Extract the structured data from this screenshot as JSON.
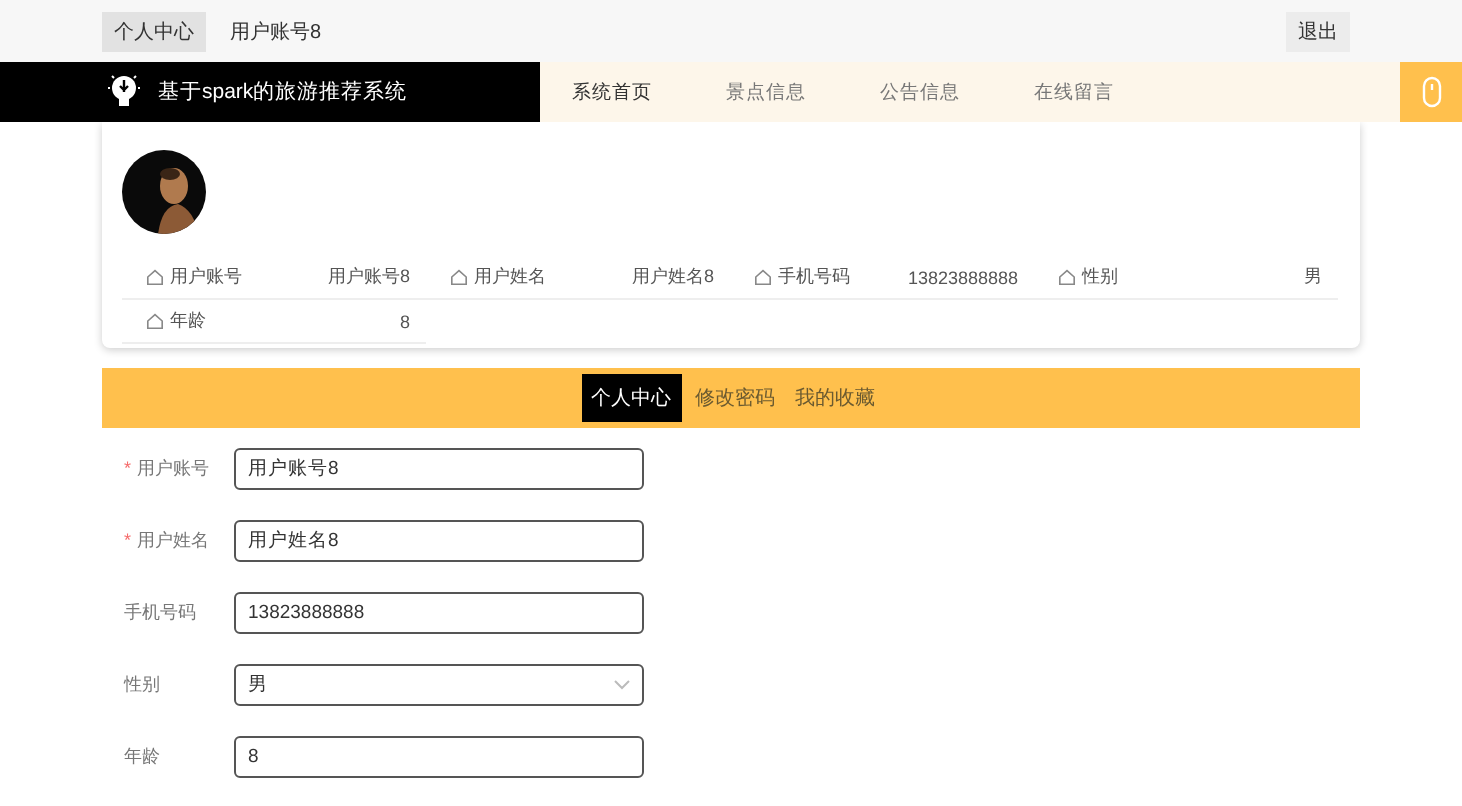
{
  "top_bar": {
    "items": [
      {
        "label": "个人中心",
        "selected": true
      },
      {
        "label": "用户账号8",
        "selected": false
      }
    ],
    "logout": "退出"
  },
  "nav": {
    "title": "基于spark的旅游推荐系统",
    "links": [
      {
        "label": "系统首页",
        "selected": true
      },
      {
        "label": "景点信息",
        "selected": false
      },
      {
        "label": "公告信息",
        "selected": false
      },
      {
        "label": "在线留言",
        "selected": false
      }
    ]
  },
  "profile": {
    "fields": [
      {
        "label": "用户账号",
        "value": "用户账号8"
      },
      {
        "label": "用户姓名",
        "value": "用户姓名8"
      },
      {
        "label": "手机号码",
        "value": "13823888888"
      },
      {
        "label": "性别",
        "value": "男"
      },
      {
        "label": "年龄",
        "value": "8"
      }
    ]
  },
  "tabs": [
    {
      "label": "个人中心",
      "selected": true
    },
    {
      "label": "修改密码",
      "selected": false
    },
    {
      "label": "我的收藏",
      "selected": false
    }
  ],
  "form": [
    {
      "required_mark": "*",
      "label": "用户账号",
      "kind": "input",
      "value": "用户账号8"
    },
    {
      "required_mark": "*",
      "label": "用户姓名",
      "kind": "input",
      "value": "用户姓名8"
    },
    {
      "label": "手机号码",
      "kind": "input",
      "value": "13823888888"
    },
    {
      "label": "性别",
      "kind": "select",
      "value": "男"
    },
    {
      "label": "年龄",
      "kind": "input",
      "value": "8"
    }
  ]
}
